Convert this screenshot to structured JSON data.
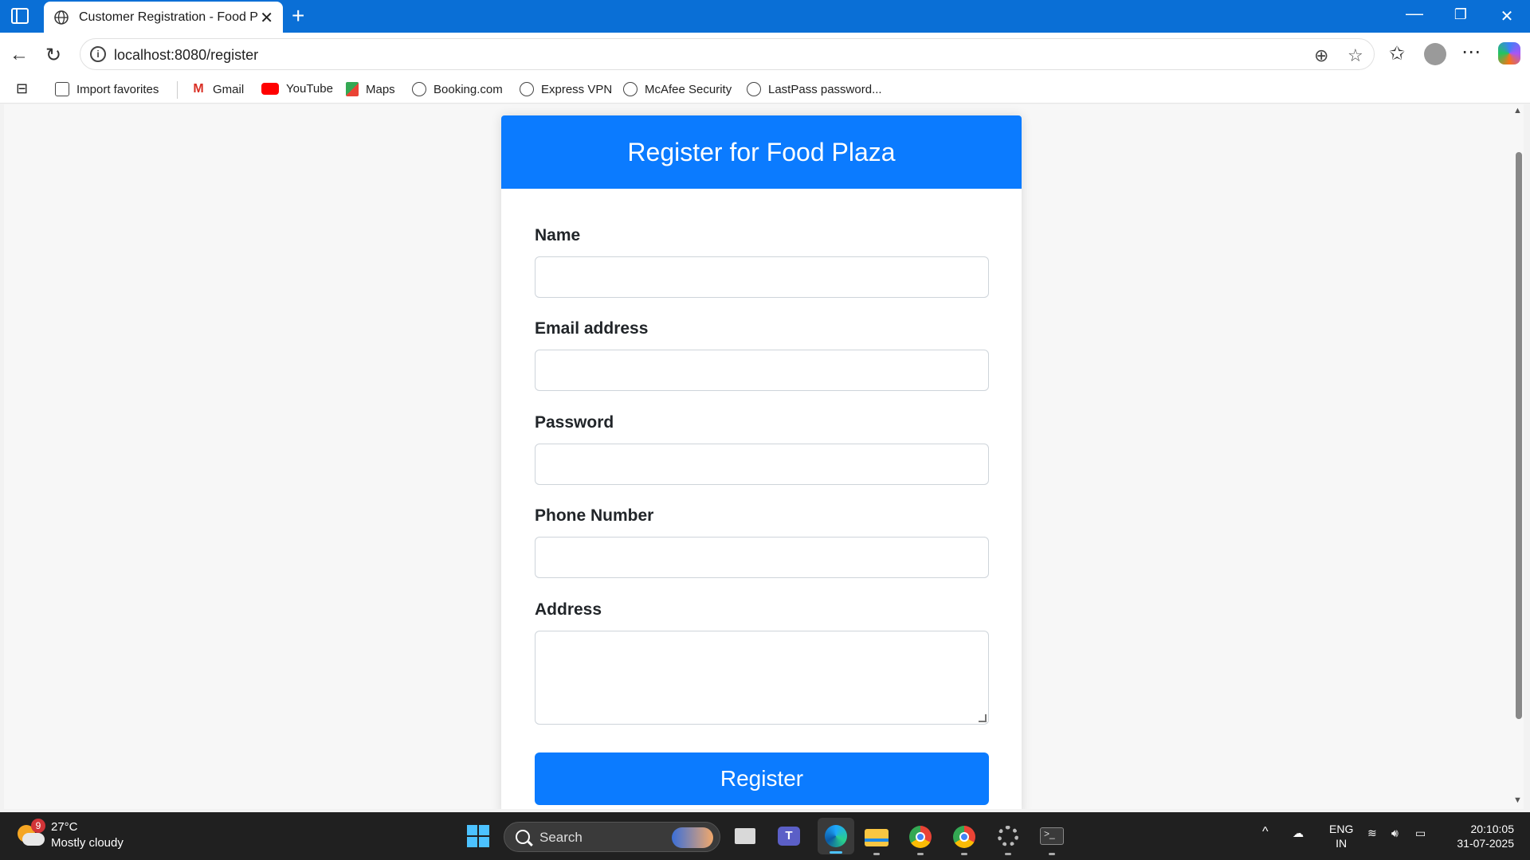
{
  "browser": {
    "tab_title": "Customer Registration - Food Pla",
    "new_tab": "+",
    "url": "localhost:8080/register",
    "window_controls": {
      "minimize": "—",
      "restore": "❐",
      "close": "✕"
    }
  },
  "favorites": [
    {
      "label": "Import favorites",
      "icon": "import-icon"
    },
    {
      "label": "Gmail",
      "icon": "gmail-icon"
    },
    {
      "label": "YouTube",
      "icon": "youtube-icon"
    },
    {
      "label": "Maps",
      "icon": "maps-icon"
    },
    {
      "label": "Booking.com",
      "icon": "globe-icon"
    },
    {
      "label": "Express VPN",
      "icon": "globe-icon"
    },
    {
      "label": "McAfee Security",
      "icon": "globe-icon"
    },
    {
      "label": "LastPass password...",
      "icon": "globe-icon"
    }
  ],
  "form": {
    "title": "Register for Food Plaza",
    "fields": {
      "name": {
        "label": "Name",
        "value": ""
      },
      "email": {
        "label": "Email address",
        "value": ""
      },
      "password": {
        "label": "Password",
        "value": ""
      },
      "phone": {
        "label": "Phone Number",
        "value": ""
      },
      "address": {
        "label": "Address",
        "value": ""
      }
    },
    "submit_label": "Register",
    "accent_color": "#0b7bff"
  },
  "taskbar": {
    "weather": {
      "badge": "9",
      "temp": "27°C",
      "condition": "Mostly cloudy"
    },
    "search_placeholder": "Search",
    "language": {
      "line1": "ENG",
      "line2": "IN"
    },
    "clock": {
      "time": "20:10:05",
      "date": "31-07-2025"
    },
    "apps": [
      "task-view",
      "teams",
      "edge",
      "file-explorer",
      "chrome-profile-a",
      "chrome-profile-h",
      "settings",
      "terminal"
    ]
  }
}
